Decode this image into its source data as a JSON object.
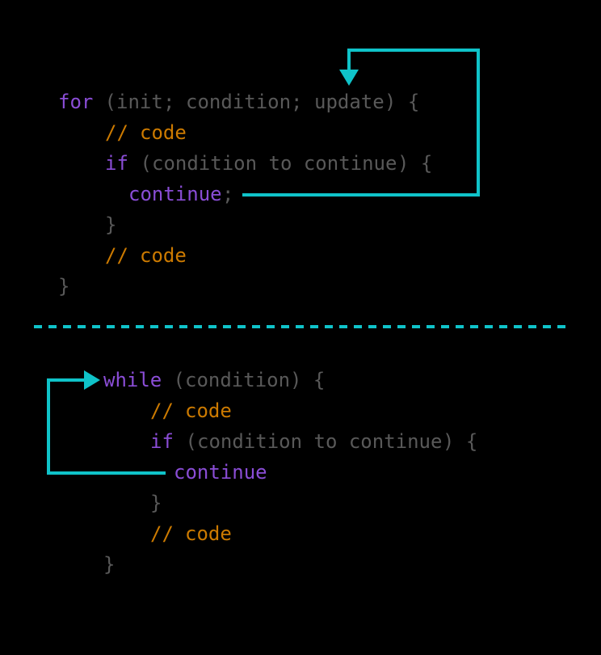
{
  "for_block": {
    "line1": {
      "kw_for": "for",
      "open": " (",
      "init": "init",
      "sep1": "; ",
      "cond": "condition",
      "sep2": "; ",
      "upd": "update",
      "close": ") {"
    },
    "line2": {
      "sl": "// ",
      "code": "code"
    },
    "line3": {
      "kw_if": "if",
      "open": " (",
      "cond": "condition to continue",
      "close": ") {"
    },
    "line4": {
      "kw_continue": "continue",
      "semi": ";"
    },
    "line5": {
      "brace": "}"
    },
    "line6": {
      "sl": "// ",
      "code": "code"
    },
    "line7": {
      "brace": "}"
    }
  },
  "while_block": {
    "line1": {
      "kw_while": "while",
      "open": " (",
      "cond": "condition",
      "close": ") {"
    },
    "line2": {
      "sl": "// ",
      "code": "code"
    },
    "line3": {
      "kw_if": "if",
      "open": " (",
      "cond": "condition to continue",
      "close": ") {"
    },
    "line4": {
      "kw_continue": "continue"
    },
    "line5": {
      "brace": "}"
    },
    "line6": {
      "sl": "// ",
      "code": "code"
    },
    "line7": {
      "brace": "}"
    }
  },
  "colors": {
    "arrow": "#0fc3c9",
    "keyword": "#8a4dd6",
    "comment": "#cc7a00",
    "punct": "#595959"
  }
}
